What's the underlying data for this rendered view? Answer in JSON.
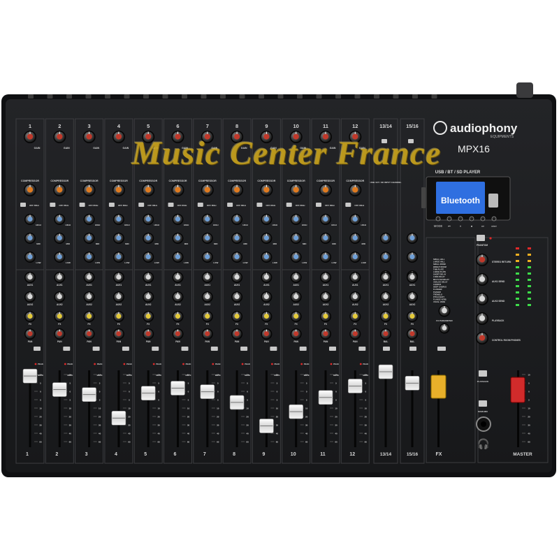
{
  "brand": {
    "name": "audiophony",
    "sub": "EQUIPMENTS",
    "model": "MPX16"
  },
  "watermark": "Music Center France",
  "player": {
    "title": "USB / BT / SD  PLAYER",
    "display": "Bluetooth",
    "buttons": [
      "MODE",
      "⏮",
      "⏸",
      "⏹",
      "⏭",
      "⏭⏭"
    ]
  },
  "mono_channels": [
    "1",
    "2",
    "3",
    "4",
    "5",
    "6",
    "7",
    "8",
    "9",
    "10",
    "11",
    "12"
  ],
  "stereo_channels": [
    "13/14",
    "15/16"
  ],
  "labels": {
    "gain": "GAIN",
    "compressor": "COMPRESSOR",
    "comp_btn": "OFF 80Hz",
    "eq": [
      "HIGH",
      "MID",
      "LOW"
    ],
    "aux": [
      "AUX1",
      "AUX2",
      "FX"
    ],
    "pan": "PAN",
    "bal": "BAL",
    "peak": "PEAK",
    "mute": "MUTE",
    "fx": "FX",
    "master": "MASTER",
    "phantom": "PHANTOM",
    "playback": "PLAYBACK",
    "main_mix": "MAIN MIX",
    "fx_param": "FX PARAMETER",
    "usb_input": "USB / BT / SD INPUT CHANNEL"
  },
  "master_knobs": [
    "STEREO RETURN",
    "AUX1 SEND",
    "AUX2 SEND",
    "PLAYBACK",
    "CONTROL ROOM PHONES"
  ],
  "fx_presets": [
    "SMALL HALL",
    "LARGE HALL",
    "SMALL ROOM",
    "BRIGHT ROOM",
    "THIN PLATE",
    "LARGE PLATE",
    "SHORT DELAY",
    "LONG DELAY",
    "MULTI-TAP DELAY",
    "ANALOG DELAY",
    "CHORUS",
    "DEEP CHORUS",
    "FLANGER",
    "PHASER",
    "TREMOLO",
    "PITCH SHIFT",
    "FLANGE VERB",
    "VOCAL VERB"
  ],
  "fader_scale": [
    "10",
    "5",
    "0",
    "5",
    "10",
    "20",
    "30",
    "40",
    "60"
  ],
  "fader_levels": [
    0.92,
    0.73,
    0.66,
    0.33,
    0.68,
    0.75,
    0.7,
    0.55,
    0.22,
    0.42,
    0.62,
    0.78,
    0.98,
    0.82,
    0.92,
    0.86
  ],
  "colors": {
    "panel": "#1c1d1f",
    "gain_knob": "#c0392b",
    "comp_knob": "#e07b20",
    "eq_knob": "#6f9fd6",
    "aux_knob": "#d9d9d9",
    "fx_knob": "#e3c93a",
    "pan_knob": "#c0392b",
    "master_fader": "#d12b2b",
    "fx_fader": "#e8b02a",
    "led_green": "#3ddc4a",
    "led_amber": "#f0b020",
    "led_red": "#e02a2a",
    "lcd": "#2f6fe0"
  }
}
